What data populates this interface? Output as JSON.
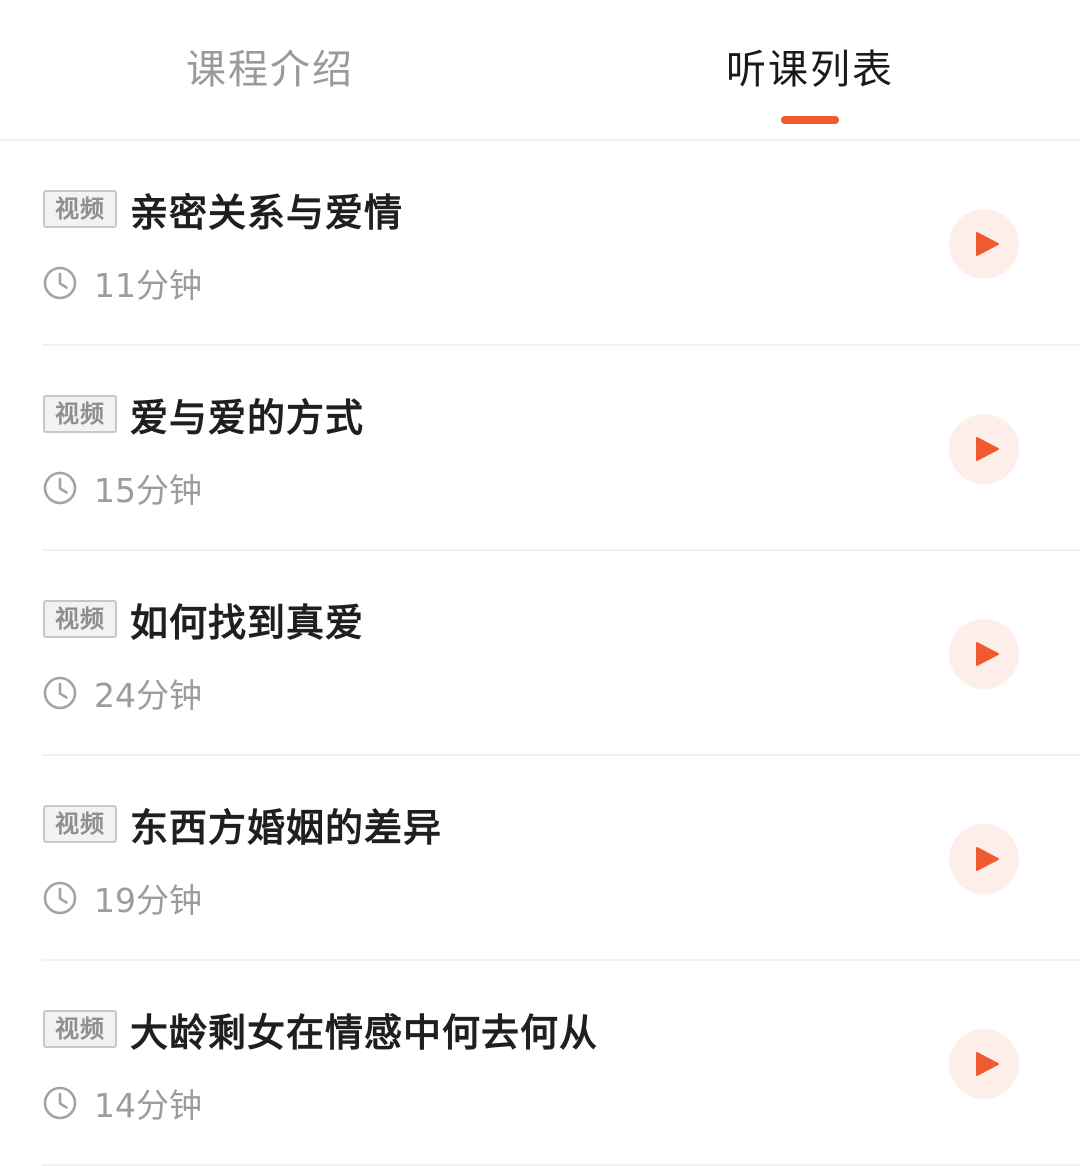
{
  "tabs": [
    {
      "label": "课程介绍",
      "active": false
    },
    {
      "label": "听课列表",
      "active": true
    }
  ],
  "accent_color": "#ef5b2e",
  "badge_label": "视频",
  "lessons": [
    {
      "title": "亲密关系与爱情",
      "duration": "11分钟"
    },
    {
      "title": "爱与爱的方式",
      "duration": "15分钟"
    },
    {
      "title": "如何找到真爱",
      "duration": "24分钟"
    },
    {
      "title": "东西方婚姻的差异",
      "duration": "19分钟"
    },
    {
      "title": "大龄剩女在情感中何去何从",
      "duration": "14分钟"
    }
  ],
  "icons": {
    "clock": "clock-icon",
    "play": "play-icon"
  }
}
